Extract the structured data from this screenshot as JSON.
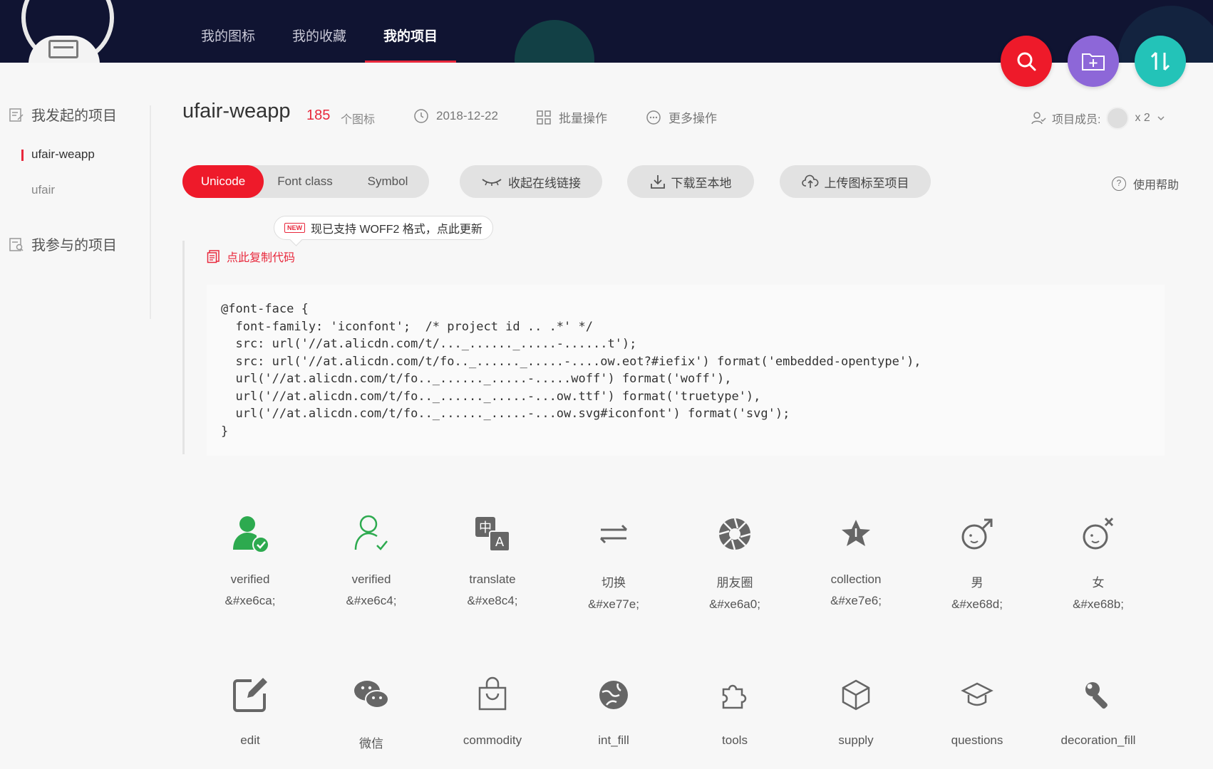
{
  "nav": {
    "items": [
      {
        "label": "我的图标"
      },
      {
        "label": "我的收藏"
      },
      {
        "label": "我的项目"
      }
    ]
  },
  "fabs": [
    "search-icon",
    "add-folder-icon",
    "sort-icon"
  ],
  "sidebar": {
    "group1": "我发起的项目",
    "items": [
      "ufair-weapp",
      "ufair"
    ],
    "group2": "我参与的项目"
  },
  "project": {
    "name": "ufair-weapp",
    "count": "185",
    "count_unit": "个图标",
    "date": "2018-12-22",
    "batch": "批量操作",
    "more": "更多操作",
    "members_label": "项目成员:",
    "members_count": "x 2"
  },
  "tabs": [
    "Unicode",
    "Font class",
    "Symbol"
  ],
  "actions": {
    "collapse": "收起在线链接",
    "download": "下载至本地",
    "upload": "上传图标至项目",
    "help": "使用帮助"
  },
  "tip": {
    "badge": "NEW",
    "text": "现已支持 WOFF2 格式，点此更新"
  },
  "copy_label": "点此复制代码",
  "code_lines": [
    "@font-face {",
    "  font-family: 'iconfont';  /* project id .. .*' */",
    "  src: url('//at.alicdn.com/t/..._......_.....-......t');",
    "  src: url('//at.alicdn.com/t/fo.._......_.....-....ow.eot?#iefix') format('embedded-opentype'),",
    "  url('//at.alicdn.com/t/fo.._......_.....-.....woff') format('woff'),",
    "  url('//at.alicdn.com/t/fo.._......_.....-...ow.ttf') format('truetype'),",
    "  url('//at.alicdn.com/t/fo.._......_.....-...ow.svg#iconfont') format('svg');",
    "}"
  ],
  "icons": [
    {
      "name": "verified",
      "code": "&#xe6ca;",
      "icon": "user-verified-filled-icon"
    },
    {
      "name": "verified",
      "code": "&#xe6c4;",
      "icon": "user-verified-outline-icon"
    },
    {
      "name": "translate",
      "code": "&#xe8c4;",
      "icon": "translate-icon"
    },
    {
      "name": "切换",
      "code": "&#xe77e;",
      "icon": "switch-arrows-icon"
    },
    {
      "name": "朋友圈",
      "code": "&#xe6a0;",
      "icon": "moments-shutter-icon"
    },
    {
      "name": "collection",
      "code": "&#xe7e6;",
      "icon": "star-icon"
    },
    {
      "name": "男",
      "code": "&#xe68d;",
      "icon": "male-icon"
    },
    {
      "name": "女",
      "code": "&#xe68b;",
      "icon": "female-icon"
    },
    {
      "name": "edit",
      "code": "",
      "icon": "edit-icon"
    },
    {
      "name": "微信",
      "code": "",
      "icon": "wechat-icon"
    },
    {
      "name": "commodity",
      "code": "",
      "icon": "shopping-bag-icon"
    },
    {
      "name": "int_fill",
      "code": "",
      "icon": "globe-fill-icon"
    },
    {
      "name": "tools",
      "code": "",
      "icon": "puzzle-icon"
    },
    {
      "name": "supply",
      "code": "",
      "icon": "cube-icon"
    },
    {
      "name": "questions",
      "code": "",
      "icon": "graduation-cap-icon"
    },
    {
      "name": "decoration_fill",
      "code": "",
      "icon": "wrench-fill-icon"
    }
  ],
  "colors": {
    "nav_bg": "#101432",
    "accent": "#ee1a2a",
    "fab_purple": "#8d67d8",
    "fab_teal": "#23c3b8",
    "icon_green": "#2daa4f"
  }
}
